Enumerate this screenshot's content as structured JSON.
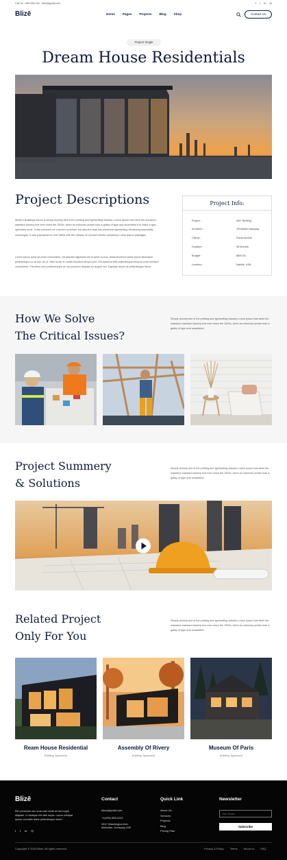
{
  "topbar": {
    "contact": "Call Us: +889 555 235  ·  blizo@gmail.com",
    "socials": [
      "f",
      "t",
      "in",
      "◎"
    ]
  },
  "nav": {
    "logo": "Blizē",
    "items": [
      "Home",
      "Pages",
      "Projects",
      "Blog",
      "Shop"
    ],
    "cta": "Contact Us"
  },
  "hero": {
    "pill": "Project Single",
    "title": "Dream House Residentials"
  },
  "description": {
    "title": "Project Descriptions",
    "p1": "Modern Buildings Ipsum is simply dummy text of the printing and typesetting industry. Lorem Ipsum has been the industry's standard dummy text ever since the 1500s, when an unknown printer took a galley of type and scrambled it to make a type specimen book. It has survived not only five centuries, but also the leap into electronic typesetting, remaining essentially unchanged. It was popularised in the 1960s with the release of Letraset sheets containing Lorem Ipsum passages.",
    "p2": "Lorem ipsum dolor sit amet consectetur. Sit aliquam dignissim elit id amet cursus. Nulla tincidunt varius purus bibendum pellentesque eu at nec vel ut. Nibh tortor et urnibh tincidunt tempor prin. Est placerat felis pellentesque tempus cond mentum consectetur. Faucibus nunc pellentesque ac nus posuere aliquam mi augue orci. Egestas donec at pellentesque lacus."
  },
  "info": {
    "title": "Project Info:",
    "rows": [
      {
        "label": "Project :",
        "value": "ANT Building"
      },
      {
        "label": "Architect :",
        "value": "JRonthaw Haysway"
      },
      {
        "label": "Clients :",
        "value": "David Arbaris"
      },
      {
        "label": "Duration :",
        "value": "06 Months"
      },
      {
        "label": "Budget :",
        "value": "$600.50"
      },
      {
        "label": "Location :",
        "value": "Nashik, USA"
      }
    ]
  },
  "solve": {
    "title1": "How We Solve",
    "title2": "The Critical Issues?",
    "text": "Simply dummy text of the printing and typesetting industry Lorem Ipsum has been the industry's standard dummy text ever since the 1500s, when an unknown printer took a galley of type and scrambled."
  },
  "summary": {
    "title1": "Project Summery",
    "title2": "& Solutions",
    "text": "Simply dummy text of the printing and typesetting industry Lorem Ipsum has been the industry's standard dummy text ever since the 1500s, when an unknown printer took a galley of type and scrambled."
  },
  "related": {
    "title1": "Related Project",
    "title2": "Only For You",
    "text": "Simply dummy text of the printing and typesetting industry Lorem Ipsum has been the industry's standard dummy text ever since the 1500s, when an unknown printer took a galley of type and scrambled.",
    "cards": [
      {
        "title": "Ream House Residential",
        "sub": "Building, Apartment"
      },
      {
        "title": "Assembly Of Rivery",
        "sub": "Building, Apartment"
      },
      {
        "title": "Museum Of Paris",
        "sub": "Building, Apartment"
      }
    ]
  },
  "footer": {
    "logo": "Blizē",
    "about": "Elit commodo nec urna erat morbi at hac turpis aliquam. In tristique elit nibh turpis. Lacus volutpat ipsum convallis tellus pellentesque etiam.",
    "contact_title": "Contact",
    "contact_lines": [
      "blizo@gmail.com",
      "+1(206) 555-0112",
      "4517 Washington Ave.",
      "Manchter, Kentucky 495"
    ],
    "quick_title": "Quick Link",
    "quick_links": [
      "About Us",
      "Services",
      "Projects",
      "Blog",
      "Pricing Plan"
    ],
    "news_title": "Newsletter",
    "email_placeholder": "Your Email...",
    "subscribe": "Subscribe",
    "copyright": "Copyright © 2024 Blize. All rights reserved.",
    "bottom_links": [
      "Privacy & Policy",
      "Terms",
      "About us",
      "FAQ"
    ]
  },
  "colors": {
    "navy": "#0d1a3a",
    "footer_bg": "#050505",
    "band_bg": "#f6f6f6"
  }
}
